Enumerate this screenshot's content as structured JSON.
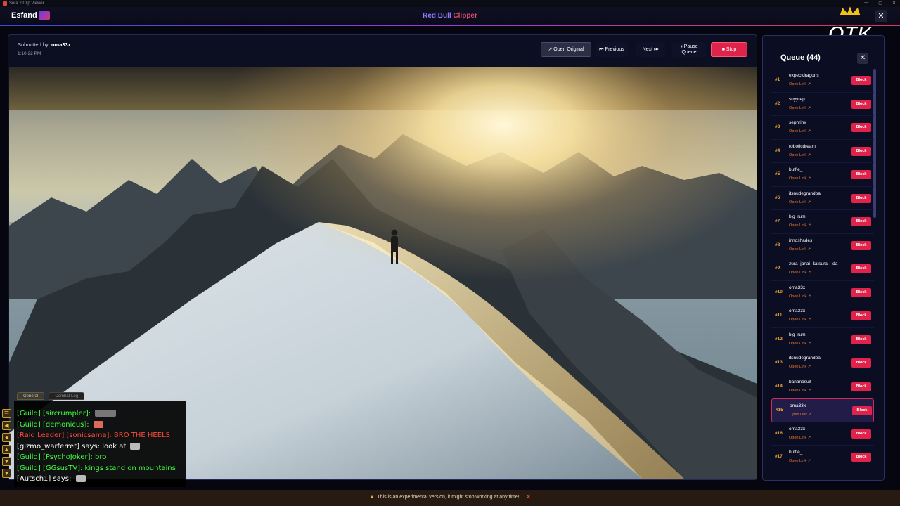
{
  "os": {
    "window_title": "Sora 2 Clip Viewer"
  },
  "header": {
    "brand": "Esfand",
    "title_main": "Red Bull",
    "title_accent": " Clipper",
    "close": "✕"
  },
  "logo": {
    "text": "OTK"
  },
  "clip": {
    "submitted_label": "Submitted by: ",
    "submitter": "oma33x",
    "time": "1:10:22 PM",
    "buttons": {
      "open_original": "↗ Open Original",
      "previous": "⏮ Previous",
      "next": "Next ⏭",
      "pause": "⏸ Pause Queue",
      "stop": "■ Stop"
    }
  },
  "chat": {
    "tabs": [
      "General",
      "Combat Log"
    ],
    "lines": [
      {
        "type": "guild",
        "text": "[Guild] [sircrumpler]: ",
        "emote": "dark"
      },
      {
        "type": "guild",
        "text": "[Guild] [demonicus]: ",
        "emote": "red"
      },
      {
        "type": "raid",
        "text": "[Raid Leader] [sonicsama]:  BRO THE HEELS",
        "emote": ""
      },
      {
        "type": "say",
        "text": "[gizmo_warferret] says:  look at ",
        "emote": "plain"
      },
      {
        "type": "guild",
        "text": "[Guild] [PsychoJoker]:  bro",
        "emote": ""
      },
      {
        "type": "guild",
        "text": "[Guild] [GGsusTV]:  kings stand on mountains",
        "emote": ""
      },
      {
        "type": "say",
        "text": "[Autsch1] says: ",
        "emote": "plain"
      }
    ]
  },
  "queue": {
    "title": "Queue (44)",
    "close": "✕",
    "link_label": "Open Link ↗",
    "block_label": "Block",
    "items": [
      {
        "num": "#1",
        "name": "expectdragons"
      },
      {
        "num": "#2",
        "name": "suyyrep"
      },
      {
        "num": "#3",
        "name": "sephrinx"
      },
      {
        "num": "#4",
        "name": "roboticdream"
      },
      {
        "num": "#5",
        "name": "buffle_"
      },
      {
        "num": "#6",
        "name": "itsnudegrandpa"
      },
      {
        "num": "#7",
        "name": "big_rum"
      },
      {
        "num": "#8",
        "name": "innoshades"
      },
      {
        "num": "#9",
        "name": "zura_janai_katsura__da"
      },
      {
        "num": "#10",
        "name": "oma33x"
      },
      {
        "num": "#11",
        "name": "oma33x"
      },
      {
        "num": "#12",
        "name": "big_rum"
      },
      {
        "num": "#13",
        "name": "itsnudegrandpa"
      },
      {
        "num": "#14",
        "name": "bananasuit"
      },
      {
        "num": "#15",
        "name": "oma33x",
        "active": true
      },
      {
        "num": "#16",
        "name": "oma33x"
      },
      {
        "num": "#17",
        "name": "buffle_"
      }
    ]
  },
  "notice": {
    "text": "This is an experimental version, it might stop working at any time!",
    "close": "✕"
  }
}
